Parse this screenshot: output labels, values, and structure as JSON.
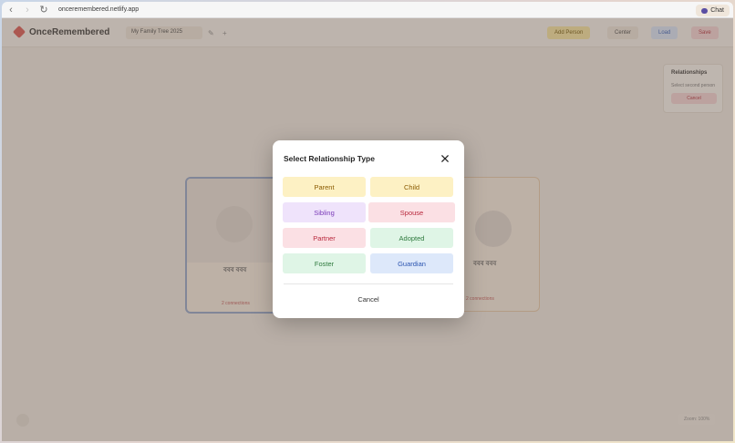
{
  "browser": {
    "url": "onceremembered.netlify.app",
    "chat_label": "Chat"
  },
  "app": {
    "brand": "OnceRemembered",
    "tree_name": "My Family Tree 2025",
    "header_buttons": {
      "add_person": "Add Person",
      "center": "Center",
      "load": "Load",
      "save": "Save"
    },
    "side_panel": {
      "title": "Relationships",
      "subtitle": "Select second person",
      "cancel": "Cancel"
    },
    "cards": [
      {
        "name": "ববব ববব",
        "link": "2 connections"
      },
      {
        "name": "ববব ববব",
        "link": "2 connections"
      }
    ],
    "zoom": "Zoom: 100%"
  },
  "modal": {
    "title": "Select Relationship Type",
    "options": [
      {
        "label": "Parent",
        "bg": "#fdf1c4",
        "fg": "#8a5a00"
      },
      {
        "label": "Child",
        "bg": "#fdf1c4",
        "fg": "#8a5a00"
      },
      {
        "label": "Sibling",
        "bg": "#efe3fb",
        "fg": "#7a3ab8"
      },
      {
        "label": "Spouse",
        "bg": "#fbe0e4",
        "fg": "#b8283c"
      },
      {
        "label": "Partner",
        "bg": "#fbe0e4",
        "fg": "#b8283c"
      },
      {
        "label": "Adopted",
        "bg": "#dff5e6",
        "fg": "#2f7a3e"
      },
      {
        "label": "Foster",
        "bg": "#dff5e6",
        "fg": "#2f7a3e"
      },
      {
        "label": "Guardian",
        "bg": "#dde8fa",
        "fg": "#2c55b0"
      }
    ],
    "cancel_label": "Cancel"
  }
}
